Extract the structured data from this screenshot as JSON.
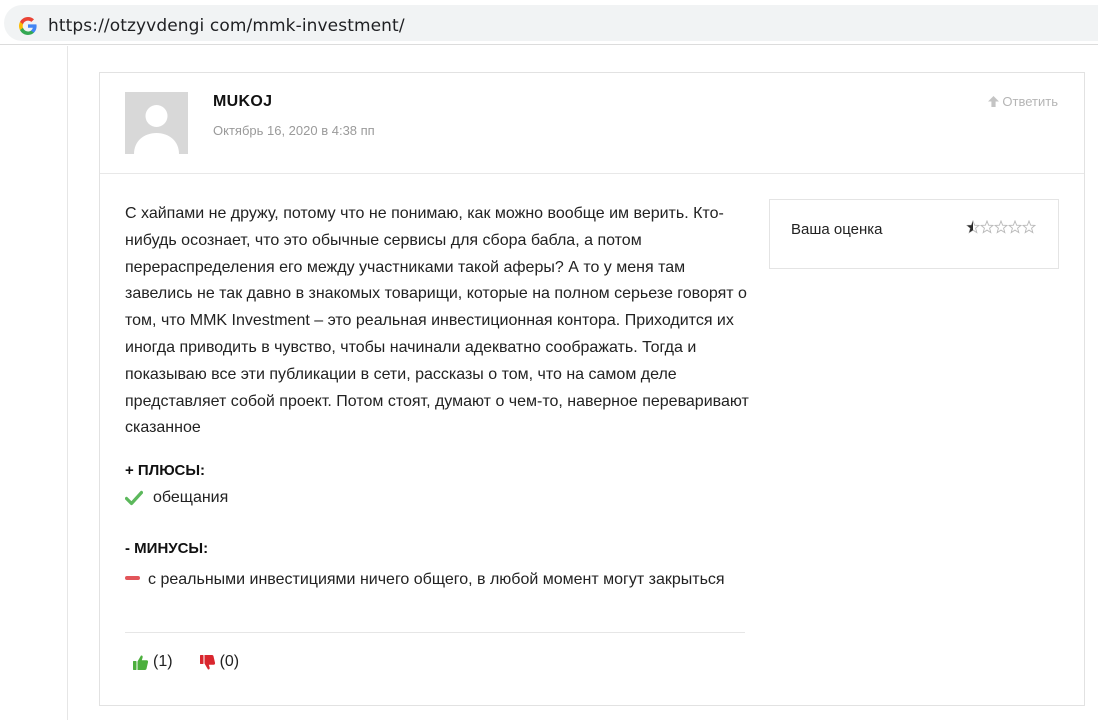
{
  "browser": {
    "url": "https://otzyvdengi com/mmk-investment/"
  },
  "comment": {
    "author": "MUKOJ",
    "date": "Октябрь 16, 2020 в 4:38 пп",
    "reply_label": "Ответить",
    "text": "С хайпами не дружу, потому что не понимаю, как можно вообще им верить. Кто-нибудь осознает, что это обычные сервисы для сбора бабла, а потом перераспределения его между участниками такой аферы? А то у меня там завелись не так давно в знакомых товарищи, которые на полном серьезе говорят о том, что MMK Investment – это реальная инвестиционная контора. Приходится их иногда приводить в чувство, чтобы начинали адекватно соображать. Тогда и показываю все эти публикации в сети, рассказы о том, что на самом деле представляет собой проект. Потом стоят, думают о чем-то, наверное переваривают сказанное",
    "rating": {
      "label": "Ваша оценка",
      "value": 0.5,
      "max": 5
    },
    "pros": {
      "title": "+ ПЛЮСЫ:",
      "items": [
        "обещания"
      ]
    },
    "cons": {
      "title": "- МИНУСЫ:",
      "items": [
        "с реальными инвестициями ничего общего, в любой момент могут закрыться"
      ]
    },
    "votes": {
      "up": "(1)",
      "down": "(0)"
    }
  },
  "colors": {
    "check": "#5cb85c",
    "minus": "#e2555a",
    "thumb_up": "#4caf3d",
    "thumb_down": "#d9262e",
    "star": "#b8b8b8",
    "star_fill": "#2b2b2b"
  },
  "icons": [
    "google-icon",
    "arrow-up-icon",
    "star-icon",
    "check-icon",
    "minus-icon",
    "thumbs-up-icon",
    "thumbs-down-icon"
  ]
}
